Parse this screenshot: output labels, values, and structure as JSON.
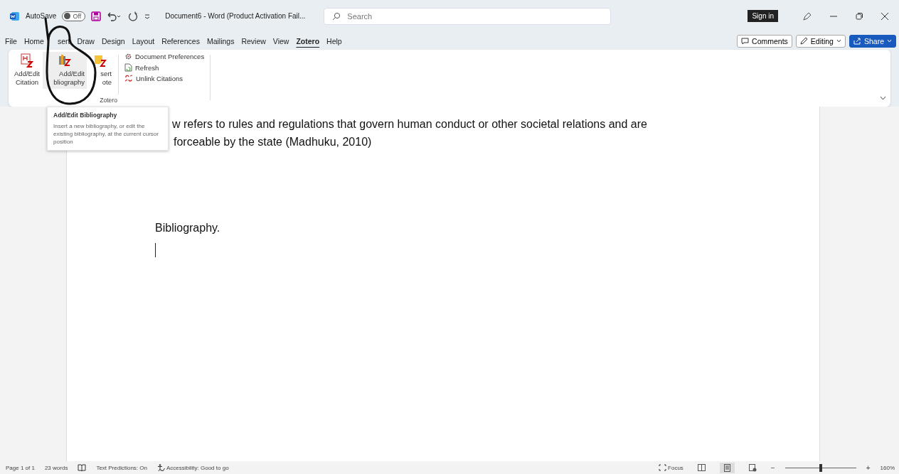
{
  "title_bar": {
    "autosave_label": "AutoSave",
    "autosave": {
      "on": false,
      "label": "Off"
    },
    "document_title": "Document6  -  Word (Product Activation Fail...",
    "search": {
      "placeholder": "Search"
    },
    "sign_in": "Sign in"
  },
  "menu_tabs": [
    {
      "label": "File",
      "selected": false
    },
    {
      "label": "Home",
      "selected": false
    },
    {
      "label": "sert",
      "selected": false
    },
    {
      "label": "Draw",
      "selected": false
    },
    {
      "label": "Design",
      "selected": false
    },
    {
      "label": "Layout",
      "selected": false
    },
    {
      "label": "References",
      "selected": false
    },
    {
      "label": "Mailings",
      "selected": false
    },
    {
      "label": "Review",
      "selected": false
    },
    {
      "label": "View",
      "selected": false
    },
    {
      "label": "Zotero",
      "selected": true
    },
    {
      "label": "Help",
      "selected": false
    }
  ],
  "ribbon_actions": [
    {
      "kind": "comments",
      "label": "Comments"
    },
    {
      "kind": "editing",
      "label": "Editing"
    },
    {
      "kind": "share",
      "label": "Share"
    }
  ],
  "ribbon": {
    "group_label": "Zotero",
    "large_buttons": [
      {
        "kind": "citation",
        "lines": [
          "Add/Edit",
          "Citation"
        ],
        "hovered": false
      },
      {
        "kind": "bibliography",
        "lines": [
          "Add/Edit",
          "bliography"
        ],
        "hovered": true
      },
      {
        "kind": "note",
        "lines": [
          "sert",
          "ote"
        ],
        "hovered": false
      }
    ],
    "small_buttons": [
      {
        "kind": "preferences",
        "label": "Document Preferences"
      },
      {
        "kind": "refresh",
        "label": "Refresh"
      },
      {
        "kind": "unlink",
        "label": "Unlink Citations"
      }
    ]
  },
  "tooltip": {
    "title": "Add/Edit Bibliography",
    "text": "Insert a new bibliography, or edit the existing bibliography, at the current cursor position"
  },
  "document": {
    "lines": [
      "w refers to rules and regulations that govern human conduct or other societal relations and are",
      "forceable by the state (Madhuku, 2010)"
    ],
    "heading": "Bibliography."
  },
  "status_bar": {
    "page": "Page 1 of 1",
    "words": "23 words",
    "text_predictions": "Text Predictions: On",
    "accessibility": "Accessibility: Good to go",
    "focus": "Focus",
    "view_buttons": [
      {
        "kind": "read",
        "selected": false
      },
      {
        "kind": "print",
        "selected": true
      },
      {
        "kind": "web",
        "selected": false
      }
    ],
    "zoom_out": "−",
    "zoom": {
      "level": 0.5,
      "reading": "160%"
    },
    "zoom_in": "+"
  }
}
